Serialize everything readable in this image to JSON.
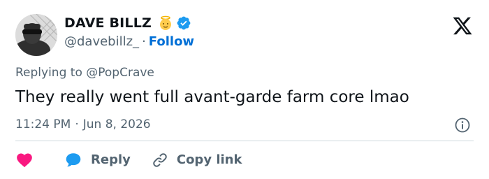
{
  "user": {
    "display_name": "DAVE BILLZ",
    "handle": "@davebillz_",
    "separator": "·",
    "follow_label": "Follow",
    "badge_emoji": "👼",
    "verified": true
  },
  "tweet": {
    "replying_to": "Replying to @PopCrave",
    "text": "They really went full avant-garde farm core lmao",
    "time": "11:24 PM",
    "date_separator": "·",
    "date": "Jun 8, 2026"
  },
  "actions": {
    "reply_label": "Reply",
    "copy_link_label": "Copy link"
  },
  "icons": {
    "logo": "x-logo-icon",
    "verified": "verified-badge-icon",
    "info": "info-icon",
    "like": "heart-icon",
    "reply": "reply-bubble-icon",
    "copy_link": "link-icon"
  },
  "colors": {
    "text_primary": "#0f1419",
    "text_secondary": "#536471",
    "follow_blue": "#006fd6",
    "verified_blue": "#1d9bf0",
    "like_pink": "#f91880",
    "reply_blue": "#1d9bf0",
    "divider": "#cfd9de"
  }
}
